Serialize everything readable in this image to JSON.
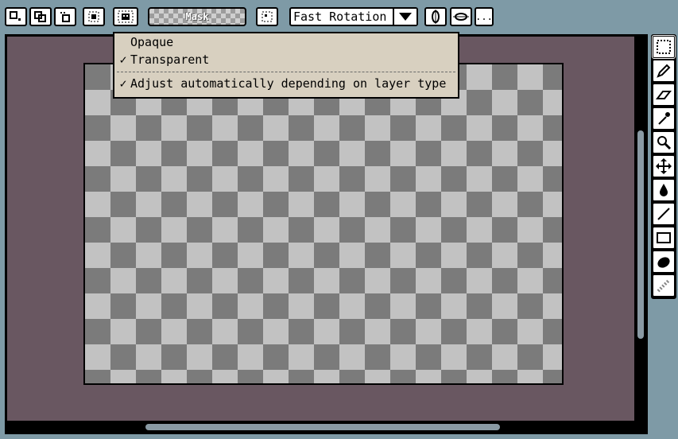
{
  "toolbar": {
    "mask_label": "Mask",
    "render_mode": "Fast Rotation",
    "more_label": "..."
  },
  "menu": {
    "items": [
      {
        "label": "Opaque",
        "checked": false
      },
      {
        "label": "Transparent",
        "checked": true
      },
      {
        "label": "Adjust automatically depending on layer type",
        "checked": true
      }
    ],
    "check_glyph": "✓"
  },
  "tools": [
    {
      "icon": "rect-select-icon",
      "selected": true
    },
    {
      "icon": "pencil-icon",
      "selected": false
    },
    {
      "icon": "eraser-icon",
      "selected": false
    },
    {
      "icon": "eyedropper-icon",
      "selected": false
    },
    {
      "icon": "zoom-icon",
      "selected": false
    },
    {
      "icon": "move-icon",
      "selected": false
    },
    {
      "icon": "fill-bucket-icon",
      "selected": false
    },
    {
      "icon": "line-icon",
      "selected": false
    },
    {
      "icon": "rectangle-icon",
      "selected": false
    },
    {
      "icon": "ellipse-icon",
      "selected": false
    },
    {
      "icon": "gradient-icon",
      "selected": false
    }
  ],
  "colors": {
    "background": "#7e9aa6",
    "canvas_bg": "#695761",
    "menu_bg": "#d8d0c0",
    "checker_dark": "#7b7b7b",
    "checker_light": "#c2c2c2"
  }
}
